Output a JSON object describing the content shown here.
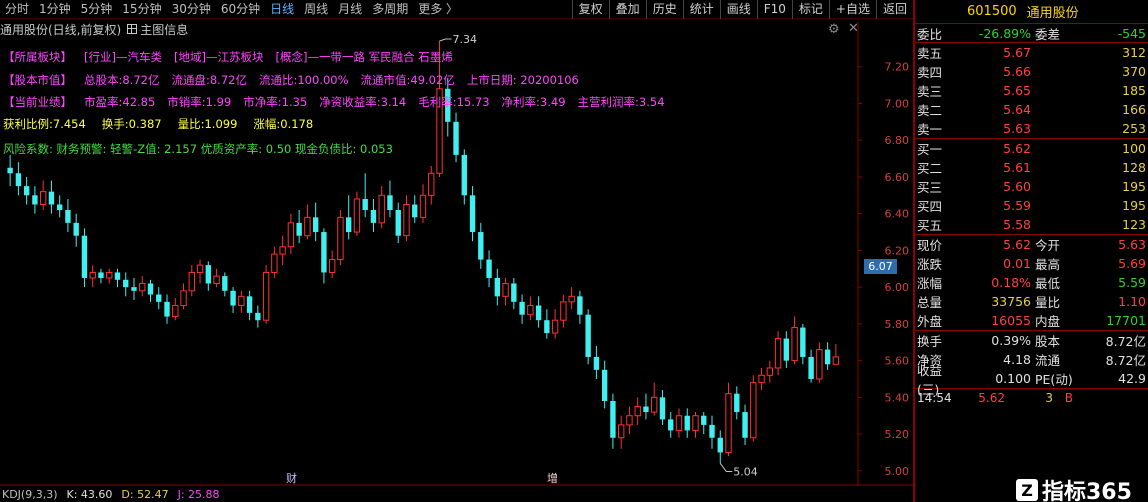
{
  "toolbar": {
    "periods": [
      "分时",
      "1分钟",
      "5分钟",
      "15分钟",
      "30分钟",
      "60分钟",
      "日线",
      "周线",
      "月线",
      "多周期",
      "更多 〉"
    ],
    "active_period": 6,
    "buttons": [
      "复权",
      "叠加",
      "历史",
      "统计",
      "画线",
      "F10",
      "标记",
      "+自选",
      "返回"
    ]
  },
  "chart_header": {
    "title": "通用股份(日线,前复权)",
    "info_button": "主图信息"
  },
  "info": {
    "sector_label": "【所属板块】",
    "industry": "[行业]—汽车类",
    "region": "[地域]—江苏板块",
    "concept": "[概念]—一带一路 军民融合 石墨烯",
    "capital_label": "【股本市值】",
    "total_shares": "总股本:8.72亿",
    "float_shares": "流通盘:8.72亿",
    "float_ratio": "流通比:100.00%",
    "float_value": "流通市值:49.02亿",
    "listing_date": "上市日期: 20200106",
    "perf_label": "【当前业绩】",
    "pe": "市盈率:42.85",
    "ps": "市销率:1.99",
    "pb": "市净率:1.35",
    "roe": "净资收益率:3.14",
    "gross_margin": "毛利率:15.73",
    "net_margin": "净利率:3.49",
    "op_margin": "主营利润率:3.54",
    "chip_ratio": "获利比例:7.454",
    "turnover": "换手:0.387",
    "vol_ratio": "量比:1.099",
    "change": "涨幅:0.178",
    "risk": "风险系数: 财务预警: 轻警-Z值: 2.157 优质资产率: 0.50 现金负债比: 0.053"
  },
  "axis": {
    "ticks": [
      "7.20",
      "7.00",
      "6.80",
      "6.60",
      "6.40",
      "6.20",
      "6.00",
      "5.80",
      "5.60",
      "5.40",
      "5.20",
      "5.00"
    ],
    "current_tag": "6.07",
    "high_label": "7.34",
    "low_label": "5.04"
  },
  "markers": {
    "fin": "财",
    "inc": "增"
  },
  "kdj": {
    "name": "KDJ(9,3,3)",
    "k": "K: 43.60",
    "d": "D: 52.47",
    "j": "J: 25.88"
  },
  "quote": {
    "code": "601500",
    "name": "通用股份",
    "weibi_label": "委比",
    "weibi": "-26.89%",
    "weicha_label": "委差",
    "weicha": "-545",
    "asks": [
      {
        "label": "卖五",
        "price": "5.67",
        "vol": "312"
      },
      {
        "label": "卖四",
        "price": "5.66",
        "vol": "370"
      },
      {
        "label": "卖三",
        "price": "5.65",
        "vol": "185"
      },
      {
        "label": "卖二",
        "price": "5.64",
        "vol": "166"
      },
      {
        "label": "卖一",
        "price": "5.63",
        "vol": "253"
      }
    ],
    "bids": [
      {
        "label": "买一",
        "price": "5.62",
        "vol": "100"
      },
      {
        "label": "买二",
        "price": "5.61",
        "vol": "128"
      },
      {
        "label": "买三",
        "price": "5.60",
        "vol": "195"
      },
      {
        "label": "买四",
        "price": "5.59",
        "vol": "195"
      },
      {
        "label": "买五",
        "price": "5.58",
        "vol": "123"
      }
    ],
    "stats": [
      {
        "l1": "现价",
        "v1": "5.62",
        "c1": "red",
        "l2": "今开",
        "v2": "5.63",
        "c2": "red"
      },
      {
        "l1": "涨跌",
        "v1": "0.01",
        "c1": "red",
        "l2": "最高",
        "v2": "5.69",
        "c2": "red"
      },
      {
        "l1": "涨幅",
        "v1": "0.18%",
        "c1": "red",
        "l2": "最低",
        "v2": "5.59",
        "c2": "gr"
      },
      {
        "l1": "总量",
        "v1": "33756",
        "c1": "yl",
        "l2": "量比",
        "v2": "1.10",
        "c2": "red"
      },
      {
        "l1": "外盘",
        "v1": "16055",
        "c1": "red",
        "l2": "内盘",
        "v2": "17701",
        "c2": "gr"
      }
    ],
    "stats2": [
      {
        "l1": "换手",
        "v1": "0.39%",
        "c1": "wh",
        "l2": "股本",
        "v2": "8.72亿",
        "c2": "wh"
      },
      {
        "l1": "净资",
        "v1": "4.18",
        "c1": "wh",
        "l2": "流通",
        "v2": "8.72亿",
        "c2": "wh"
      },
      {
        "l1": "收益(三)",
        "v1": "0.100",
        "c1": "wh",
        "l2": "PE(动)",
        "v2": "42.9",
        "c2": "wh"
      }
    ],
    "ticks": [
      {
        "t": "14:54",
        "p": "5.62",
        "q": "3",
        "b": "B"
      }
    ]
  },
  "watermark": {
    "logo": "Z",
    "text": "指标365"
  },
  "colors": {
    "up": "#ff3030",
    "down": "#40f0f0",
    "bg": "#000000"
  },
  "chart_data": {
    "type": "candlestick",
    "ylim": [
      4.95,
      7.4
    ],
    "candles": [
      [
        6.65,
        6.62,
        6.72,
        6.55
      ],
      [
        6.62,
        6.55,
        6.68,
        6.5
      ],
      [
        6.55,
        6.5,
        6.6,
        6.45
      ],
      [
        6.5,
        6.45,
        6.55,
        6.4
      ],
      [
        6.45,
        6.52,
        6.58,
        6.42
      ],
      [
        6.52,
        6.45,
        6.58,
        6.4
      ],
      [
        6.45,
        6.42,
        6.5,
        6.38
      ],
      [
        6.42,
        6.35,
        6.48,
        6.3
      ],
      [
        6.35,
        6.28,
        6.4,
        6.22
      ],
      [
        6.28,
        6.05,
        6.32,
        6.0
      ],
      [
        6.05,
        6.08,
        6.12,
        6.0
      ],
      [
        6.08,
        6.05,
        6.1,
        6.02
      ],
      [
        6.05,
        6.08,
        6.1,
        6.02
      ],
      [
        6.08,
        6.04,
        6.1,
        6.0
      ],
      [
        6.04,
        6.0,
        6.08,
        5.95
      ],
      [
        6.0,
        5.98,
        6.05,
        5.93
      ],
      [
        5.98,
        6.02,
        6.06,
        5.95
      ],
      [
        6.02,
        5.96,
        6.04,
        5.92
      ],
      [
        5.96,
        5.92,
        6.0,
        5.88
      ],
      [
        5.92,
        5.84,
        5.96,
        5.8
      ],
      [
        5.84,
        5.9,
        5.94,
        5.82
      ],
      [
        5.9,
        5.98,
        6.02,
        5.88
      ],
      [
        5.98,
        6.08,
        6.12,
        5.95
      ],
      [
        6.08,
        6.12,
        6.15,
        6.02
      ],
      [
        6.12,
        6.02,
        6.14,
        5.98
      ],
      [
        6.02,
        6.06,
        6.1,
        6.0
      ],
      [
        6.06,
        5.98,
        6.08,
        5.95
      ],
      [
        5.98,
        5.9,
        6.0,
        5.86
      ],
      [
        5.9,
        5.95,
        5.98,
        5.86
      ],
      [
        5.95,
        5.86,
        5.98,
        5.82
      ],
      [
        5.86,
        5.82,
        5.9,
        5.78
      ],
      [
        5.82,
        6.08,
        6.12,
        5.8
      ],
      [
        6.08,
        6.18,
        6.22,
        6.05
      ],
      [
        6.18,
        6.22,
        6.28,
        6.12
      ],
      [
        6.22,
        6.35,
        6.4,
        6.18
      ],
      [
        6.35,
        6.28,
        6.42,
        6.24
      ],
      [
        6.28,
        6.38,
        6.45,
        6.26
      ],
      [
        6.38,
        6.3,
        6.46,
        6.25
      ],
      [
        6.3,
        6.08,
        6.32,
        6.02
      ],
      [
        6.08,
        6.15,
        6.2,
        6.05
      ],
      [
        6.15,
        6.38,
        6.42,
        6.12
      ],
      [
        6.38,
        6.3,
        6.5,
        6.26
      ],
      [
        6.3,
        6.48,
        6.52,
        6.28
      ],
      [
        6.48,
        6.42,
        6.62,
        6.38
      ],
      [
        6.42,
        6.35,
        6.48,
        6.3
      ],
      [
        6.35,
        6.5,
        6.55,
        6.32
      ],
      [
        6.5,
        6.42,
        6.58,
        6.38
      ],
      [
        6.42,
        6.28,
        6.46,
        6.24
      ],
      [
        6.28,
        6.45,
        6.5,
        6.25
      ],
      [
        6.45,
        6.38,
        6.5,
        6.35
      ],
      [
        6.38,
        6.5,
        6.56,
        6.35
      ],
      [
        6.5,
        6.62,
        6.66,
        6.45
      ],
      [
        6.62,
        7.08,
        7.34,
        6.6
      ],
      [
        7.08,
        6.9,
        7.14,
        6.82
      ],
      [
        6.9,
        6.72,
        6.95,
        6.68
      ],
      [
        6.72,
        6.5,
        6.75,
        6.45
      ],
      [
        6.5,
        6.3,
        6.55,
        6.25
      ],
      [
        6.3,
        6.15,
        6.35,
        6.1
      ],
      [
        6.15,
        6.05,
        6.2,
        6.0
      ],
      [
        6.05,
        5.95,
        6.1,
        5.9
      ],
      [
        5.95,
        6.02,
        6.05,
        5.9
      ],
      [
        6.02,
        5.92,
        6.05,
        5.88
      ],
      [
        5.92,
        5.85,
        5.96,
        5.8
      ],
      [
        5.85,
        5.9,
        5.95,
        5.82
      ],
      [
        5.9,
        5.82,
        5.95,
        5.78
      ],
      [
        5.82,
        5.75,
        5.88,
        5.72
      ],
      [
        5.75,
        5.82,
        5.88,
        5.72
      ],
      [
        5.82,
        5.92,
        5.96,
        5.78
      ],
      [
        5.92,
        5.95,
        6.0,
        5.88
      ],
      [
        5.95,
        5.85,
        5.98,
        5.8
      ],
      [
        5.85,
        5.62,
        5.88,
        5.58
      ],
      [
        5.62,
        5.55,
        5.68,
        5.5
      ],
      [
        5.55,
        5.38,
        5.6,
        5.34
      ],
      [
        5.38,
        5.18,
        5.42,
        5.12
      ],
      [
        5.18,
        5.25,
        5.3,
        5.12
      ],
      [
        5.25,
        5.3,
        5.35,
        5.2
      ],
      [
        5.3,
        5.35,
        5.4,
        5.25
      ],
      [
        5.35,
        5.32,
        5.42,
        5.28
      ],
      [
        5.32,
        5.4,
        5.48,
        5.3
      ],
      [
        5.4,
        5.28,
        5.44,
        5.25
      ],
      [
        5.28,
        5.22,
        5.32,
        5.18
      ],
      [
        5.22,
        5.3,
        5.34,
        5.18
      ],
      [
        5.3,
        5.22,
        5.34,
        5.18
      ],
      [
        5.22,
        5.3,
        5.32,
        5.18
      ],
      [
        5.3,
        5.25,
        5.32,
        5.2
      ],
      [
        5.25,
        5.18,
        5.3,
        5.12
      ],
      [
        5.18,
        5.1,
        5.22,
        5.04
      ],
      [
        5.1,
        5.42,
        5.48,
        5.08
      ],
      [
        5.42,
        5.32,
        5.46,
        5.28
      ],
      [
        5.32,
        5.18,
        5.36,
        5.14
      ],
      [
        5.18,
        5.48,
        5.52,
        5.16
      ],
      [
        5.48,
        5.52,
        5.56,
        5.44
      ],
      [
        5.52,
        5.56,
        5.6,
        5.48
      ],
      [
        5.56,
        5.72,
        5.76,
        5.52
      ],
      [
        5.72,
        5.6,
        5.76,
        5.56
      ],
      [
        5.6,
        5.78,
        5.84,
        5.58
      ],
      [
        5.78,
        5.62,
        5.8,
        5.58
      ],
      [
        5.62,
        5.5,
        5.66,
        5.48
      ],
      [
        5.5,
        5.66,
        5.7,
        5.48
      ],
      [
        5.66,
        5.58,
        5.7,
        5.55
      ],
      [
        5.58,
        5.62,
        5.69,
        5.59
      ]
    ]
  }
}
